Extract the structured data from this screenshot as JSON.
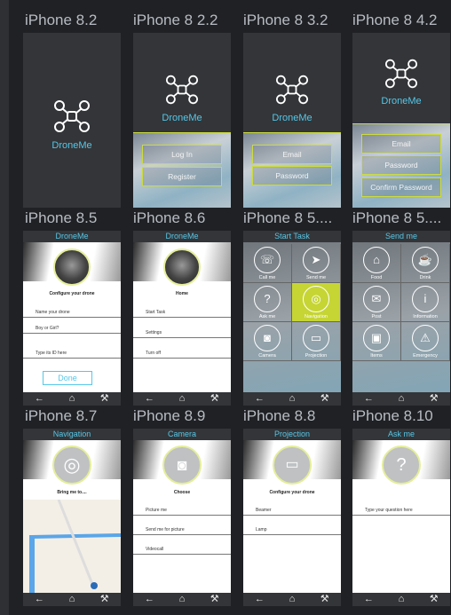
{
  "labels": [
    "iPhone 8.2",
    "iPhone 8 2.2",
    "iPhone 8 3.2",
    "iPhone 8 4.2",
    "iPhone 8.5",
    "iPhone 8.6",
    "iPhone 8 5....",
    "iPhone 8 5....",
    "iPhone 8.7",
    "iPhone 8.9",
    "iPhone 8.8",
    "iPhone 8.10"
  ],
  "brand": "DroneMe",
  "login": {
    "login_label": "Log In",
    "register_label": "Register"
  },
  "signin": {
    "email_label": "Email",
    "password_label": "Password"
  },
  "register": {
    "email_label": "Email",
    "password_label": "Password",
    "confirm_label": "Confirm Password"
  },
  "configure": {
    "title": "DroneMe",
    "heading": "Configure your drone",
    "fields": [
      "Name your drone",
      "Boy or Girl?",
      "Type its ID here"
    ],
    "done_label": "Done"
  },
  "home": {
    "title": "DroneMe",
    "heading": "Home",
    "items": [
      "Start Task",
      "Settings",
      "Turn off"
    ]
  },
  "starttask": {
    "title": "Start Task",
    "tiles": [
      "Call me",
      "Send me",
      "Ask me",
      "Navigation",
      "Camera",
      "Projection"
    ]
  },
  "sendme": {
    "title": "Send me",
    "tiles": [
      "Food",
      "Drink",
      "Post",
      "Information",
      "Items",
      "Emergency"
    ]
  },
  "navigation": {
    "title": "Navigation",
    "heading": "Bring me to...."
  },
  "camera": {
    "title": "Camera",
    "heading": "Choose",
    "items": [
      "Picture me",
      "Send me for picture",
      "Videocall"
    ]
  },
  "projection": {
    "title": "Projection",
    "heading": "Configure your drone",
    "items": [
      "Beamer",
      "Lamp"
    ]
  },
  "askme": {
    "title": "Ask me",
    "placeholder": "Type your question here"
  },
  "nav_icons": {
    "back": "←",
    "home": "⌂",
    "tools": "⚒"
  },
  "colors": {
    "accent": "#cddc39",
    "brand": "#56c7e8",
    "dark": "#333538"
  }
}
